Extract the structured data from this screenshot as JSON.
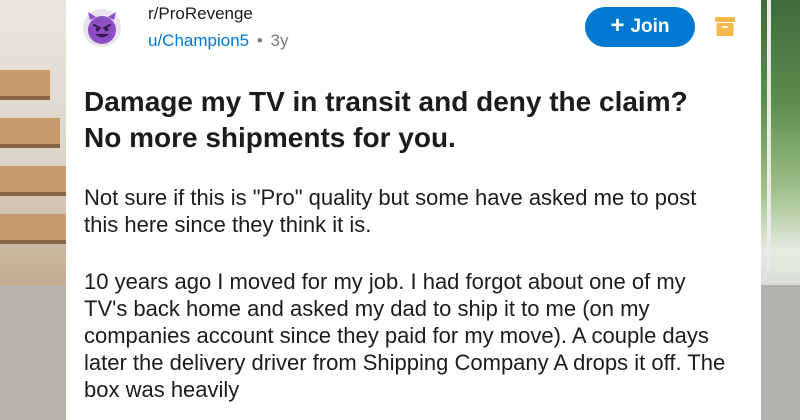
{
  "post": {
    "subreddit": "r/ProRevenge",
    "username": "u/Champion5",
    "separator": "•",
    "age": "3y",
    "join_label": "Join",
    "title": "Damage my TV in transit and deny the claim? No more shipments for you.",
    "paragraphs": [
      "Not sure if this is \"Pro\" quality but some have asked me to post this here since they think it is.",
      "10 years ago I moved for my job. I had forgot about one of my TV's back home and asked my dad to ship it to me (on my companies account since they paid for my move). A couple days later the delivery driver from Shipping Company A drops it off. The box was heavily"
    ]
  },
  "icons": {
    "avatar": "devil-emoji-avatar",
    "join": "plus-icon",
    "save": "save-archive-icon"
  },
  "colors": {
    "accent": "#0079d3",
    "avatar_purple": "#8e4fc4",
    "save_icon": "#f5b94a"
  }
}
